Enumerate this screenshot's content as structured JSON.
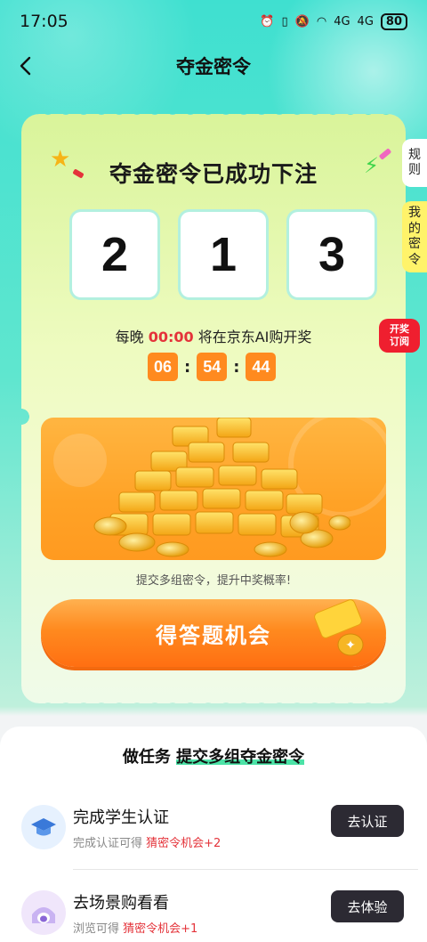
{
  "status": {
    "time": "17:05",
    "battery": "80",
    "net1": "4G",
    "net2": "4G"
  },
  "nav": {
    "title": "夺金密令"
  },
  "card": {
    "headline": "夺金密令已成功下注",
    "digits": [
      "2",
      "1",
      "3"
    ],
    "draw_prefix": "每晚",
    "draw_time": "00:00",
    "draw_suffix": "将在京东AI购开奖",
    "countdown": {
      "hours": "06",
      "minutes": "54",
      "seconds": "44"
    },
    "tip": "提交多组密令，提升中奖概率!",
    "cta_label": "得答题机会"
  },
  "side": {
    "rules": [
      "规",
      "则"
    ],
    "mycodes": [
      "我",
      "的",
      "密",
      "令"
    ],
    "subscribe": [
      "开奖",
      "订阅"
    ]
  },
  "tasks": {
    "title_prefix": "做任务",
    "title_highlight": "提交多组夺金密令",
    "items": [
      {
        "name": "完成学生认证",
        "desc_prefix": "完成认证可得",
        "desc_reward": "猜密令机会+2",
        "button": "去认证",
        "icon": "graduation-cap-icon"
      },
      {
        "name": "去场景购看看",
        "desc_prefix": "浏览可得",
        "desc_reward": "猜密令机会+1",
        "button": "去体验",
        "icon": "pet-house-icon"
      }
    ]
  },
  "colors": {
    "accent_orange": "#ff8a1f",
    "accent_red": "#e4333a",
    "dark_button": "#2c2a33",
    "teal_bg": "#3fe0d0"
  }
}
